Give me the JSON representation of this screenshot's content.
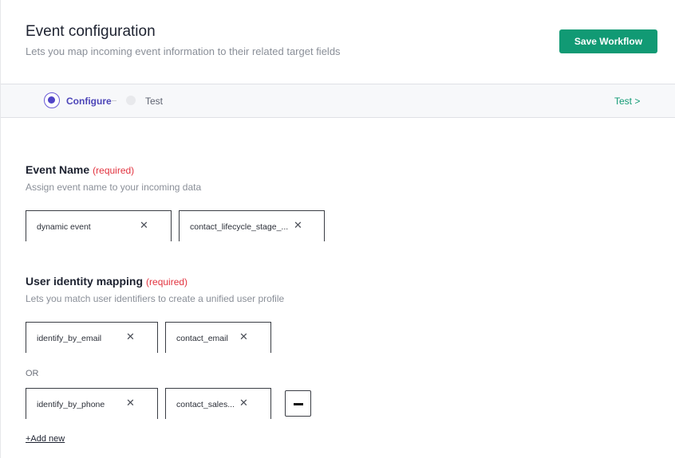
{
  "header": {
    "title": "Event configuration",
    "subtitle": "Lets you map incoming event information to their related target fields",
    "save_label": "Save Workflow"
  },
  "stepper": {
    "steps": [
      {
        "label": "Configure",
        "state": "active"
      },
      {
        "label": "Test",
        "state": "inactive"
      }
    ],
    "next_link": "Test >"
  },
  "event_name": {
    "title": "Event Name",
    "required": "(required)",
    "description": "Assign event name to your incoming data",
    "tags": [
      "dynamic event",
      "contact_lifecycle_stage_..."
    ]
  },
  "user_identity": {
    "title": "User identity mapping",
    "required": "(required)",
    "description": "Lets you match user identifiers to create a unified user profile",
    "rows": [
      {
        "identifier": "identify_by_email",
        "field": "contact_email"
      },
      {
        "identifier": "identify_by_phone",
        "field": "contact_sales..."
      }
    ],
    "or_label": "OR",
    "add_new": "+Add new"
  },
  "icons": {
    "remove_tag": "close-icon",
    "remove_row": "minus-icon"
  },
  "colors": {
    "brand_green": "#119a74",
    "active_step": "#5044c7",
    "required": "#e2333f"
  }
}
